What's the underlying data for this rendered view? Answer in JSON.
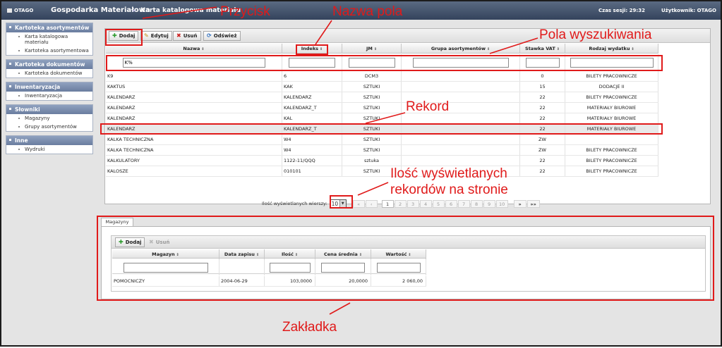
{
  "header": {
    "logo": "OTAGO",
    "app_title": "Gospodarka Materiałowa",
    "breadcrumb_sep": "►",
    "breadcrumb": "Karta katalogowa materiału",
    "session": "Czas sesji: 29:32",
    "user": "Użytkownik: OTAGO"
  },
  "sidebar": {
    "sections": [
      {
        "title": "Kartoteka asortymentów",
        "items": [
          "Karta katalogowa materiału",
          "Kartoteka asortymentowa"
        ]
      },
      {
        "title": "Kartoteka dokumentów",
        "items": [
          "Kartoteka dokumentów"
        ]
      },
      {
        "title": "Inwentaryzacja",
        "items": [
          "Inwentaryzacja"
        ]
      },
      {
        "title": "Słowniki",
        "items": [
          "Magazyny",
          "Grupy asortymentów"
        ]
      },
      {
        "title": "Inne",
        "items": [
          "Wydruki"
        ]
      }
    ]
  },
  "toolbar": {
    "add": "Dodaj",
    "edit": "Edytuj",
    "delete": "Usuń",
    "refresh": "Odśwież"
  },
  "grid": {
    "columns": [
      "Nazwa",
      "Indeks",
      "JM",
      "Grupa asortymentów",
      "Stawka VAT",
      "Rodzaj wydatku"
    ],
    "sort_glyph": "⇕",
    "filters": [
      "K%",
      "",
      "",
      "",
      "",
      ""
    ],
    "rows": [
      [
        "K9",
        "6",
        "DCM3",
        "",
        "0",
        "BILETY PRACOWNICZE"
      ],
      [
        "KAKTUS",
        "KAK",
        "SZTUKI",
        "",
        "15",
        "DODACJE II"
      ],
      [
        "KALENDARZ",
        "KALENDARZ",
        "SZTUKI",
        "",
        "22",
        "BILETY PRACOWNICZE"
      ],
      [
        "KALENDARZ",
        "KALENDARZ_T",
        "SZTUKI",
        "",
        "22",
        "MATERIAŁY BIUROWE"
      ],
      [
        "KALENDARZ",
        "KAL",
        "SZTUKI",
        "",
        "22",
        "MATERIAŁY BIUROWE"
      ],
      [
        "KALENDARZ",
        "KALENDARZ_T",
        "SZTUKI",
        "",
        "22",
        "MATERIAŁY BIUROWE"
      ],
      [
        "KALKA TECHNICZNA",
        "W4",
        "SZTUKI",
        "",
        "ZW",
        ""
      ],
      [
        "KALKA TECHNICZNA",
        "W4",
        "SZTUKI",
        "",
        "ZW",
        "BILETY PRACOWNICZE"
      ],
      [
        "KALKULATORY",
        "1122-11/QQQ",
        "sztuka",
        "",
        "22",
        "BILETY PRACOWNICZE"
      ],
      [
        "KALOSZE",
        "010101",
        "SZTUKI",
        "",
        "22",
        "BILETY PRACOWNICZE"
      ]
    ],
    "selected_row": 5
  },
  "pager": {
    "label": "Ilość wyświetlanych wierszy:",
    "rows_per_page": "10",
    "first": "«",
    "prev": "‹",
    "pages": [
      "1",
      "2",
      "3",
      "4",
      "5",
      "6",
      "7",
      "8",
      "9",
      "10"
    ],
    "current_page": "1",
    "next": "»",
    "last": "»»"
  },
  "tabs": {
    "active": "Magazyny"
  },
  "sub_toolbar": {
    "add": "Dodaj",
    "delete": "Usuń"
  },
  "sub_grid": {
    "columns": [
      "Magazyn",
      "Data zapisu",
      "Ilość",
      "Cena średnia",
      "Wartość"
    ],
    "rows": [
      [
        "POMOCNICZY",
        "2004-06-29",
        "103,0000",
        "20,0000",
        "2 060,00"
      ]
    ]
  },
  "annotations": {
    "przycisk": "Przycisk",
    "nazwa_pola": "Nazwa pola",
    "pola_wyszukiwania": "Pola wyszukiwania",
    "rekord": "Rekord",
    "ilosc_line1": "Ilość wyświetlanych",
    "ilosc_line2": "rekordów na stronie",
    "zakladka": "Zakładka"
  },
  "colors": {
    "annotation": "#e01a1a",
    "header": "#3f4e68",
    "sidebar_header": "#7d8fb0"
  }
}
